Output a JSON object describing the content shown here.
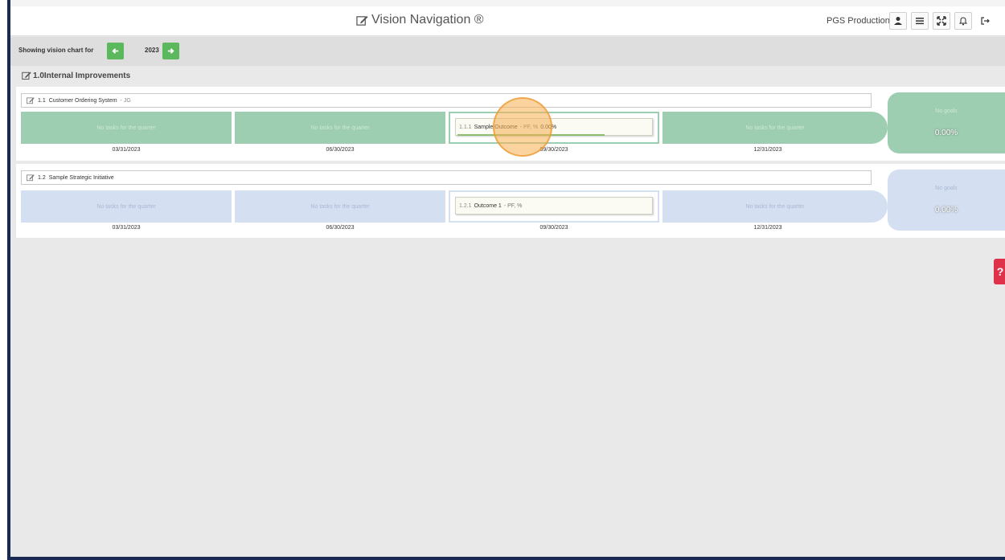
{
  "header": {
    "title": "Vision Navigation ®",
    "org": "PGS Production",
    "icons": [
      "user-icon",
      "menu-icon",
      "expand-icon",
      "bell-icon",
      "logout-icon"
    ]
  },
  "yearbar": {
    "label": "Showing vision chart for",
    "year": "2023"
  },
  "group": {
    "title": "1.0Internal Improvements"
  },
  "no_tasks": "No tasks for the quarter",
  "no_goals": "No goals",
  "initiatives": [
    {
      "code": "1.1",
      "name": "Customer Ordering System",
      "owner": "- JG",
      "theme": "green",
      "outcome": {
        "code": "1.1.1",
        "name": "Sample Outcome",
        "meta": "- PF, %",
        "value": "0.00%",
        "progress": 0.75
      },
      "dates": [
        "03/31/2023",
        "06/30/2023",
        "09/30/2023",
        "12/31/2023"
      ],
      "goal_pct": "0.00%"
    },
    {
      "code": "1.2",
      "name": "Sample Strategic Initiative",
      "owner": "",
      "theme": "blue",
      "outcome": {
        "code": "1.2.1",
        "name": "Outcome 1",
        "meta": "- PF, %",
        "value": "",
        "progress": 0
      },
      "dates": [
        "03/31/2023",
        "06/30/2023",
        "09/30/2023",
        "12/31/2023"
      ],
      "goal_pct": "0.00%"
    }
  ],
  "help_badge": "?",
  "colors": {
    "accent_green": "#5cb85c",
    "row_green": "#9dceb1",
    "row_blue": "#d4dff1",
    "frame": "#1b2a52",
    "badge": "#e0314b"
  }
}
